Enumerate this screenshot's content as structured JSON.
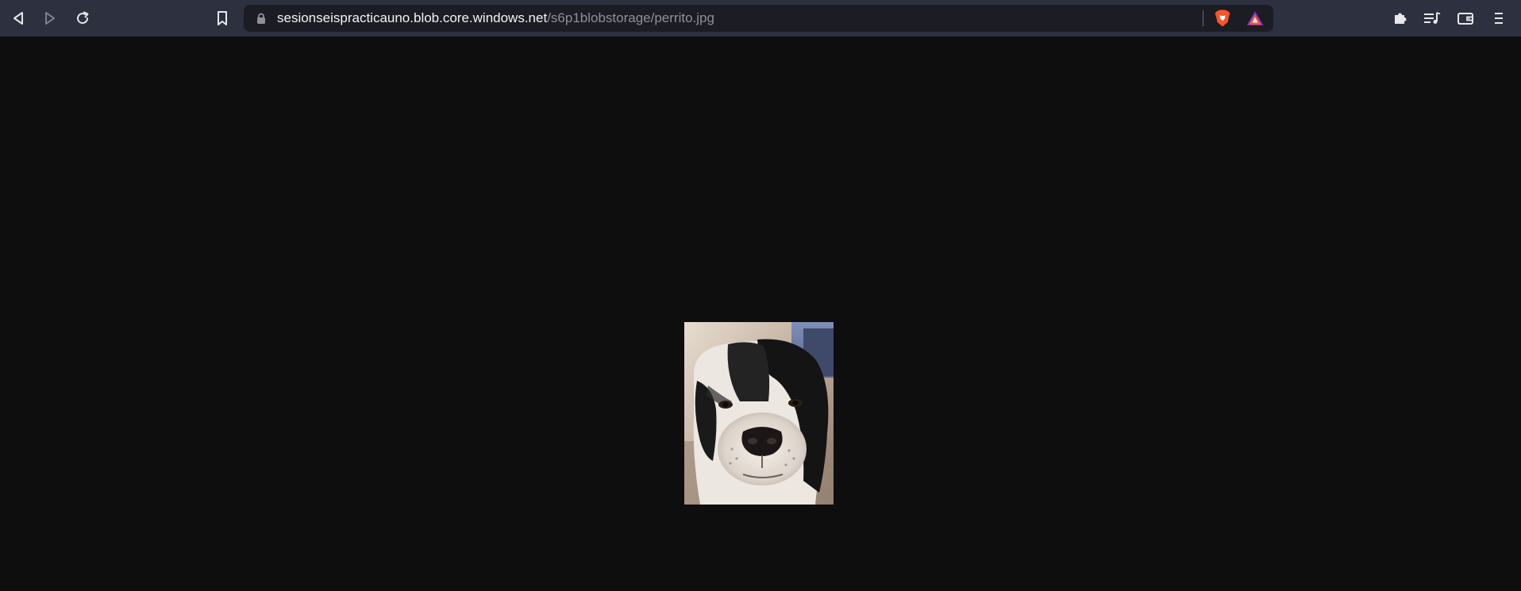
{
  "browser": {
    "address_bar": {
      "host": "sesionseispracticauno.blob.core.windows.net",
      "path": "/s6p1blobstorage/perrito.jpg"
    },
    "toolbar_icons": {
      "back": "back-arrow-icon",
      "forward": "forward-arrow-icon",
      "reload": "reload-icon",
      "bookmark": "bookmark-icon",
      "lock": "lock-icon",
      "brave_shields": "brave-lion-icon",
      "rewards": "brave-rewards-icon",
      "extensions": "puzzle-piece-icon",
      "playlist": "playlist-icon",
      "wallet": "wallet-icon",
      "menu": "hamburger-menu-icon"
    }
  },
  "content": {
    "image_subject": "dog-photo"
  },
  "colors": {
    "toolbar_bg": "#2d303e",
    "urlbar_bg": "#1b1c24",
    "page_bg": "#0e0e0e",
    "brave_orange": "#fb542b",
    "rewards_purple": "#6a2fd6"
  }
}
